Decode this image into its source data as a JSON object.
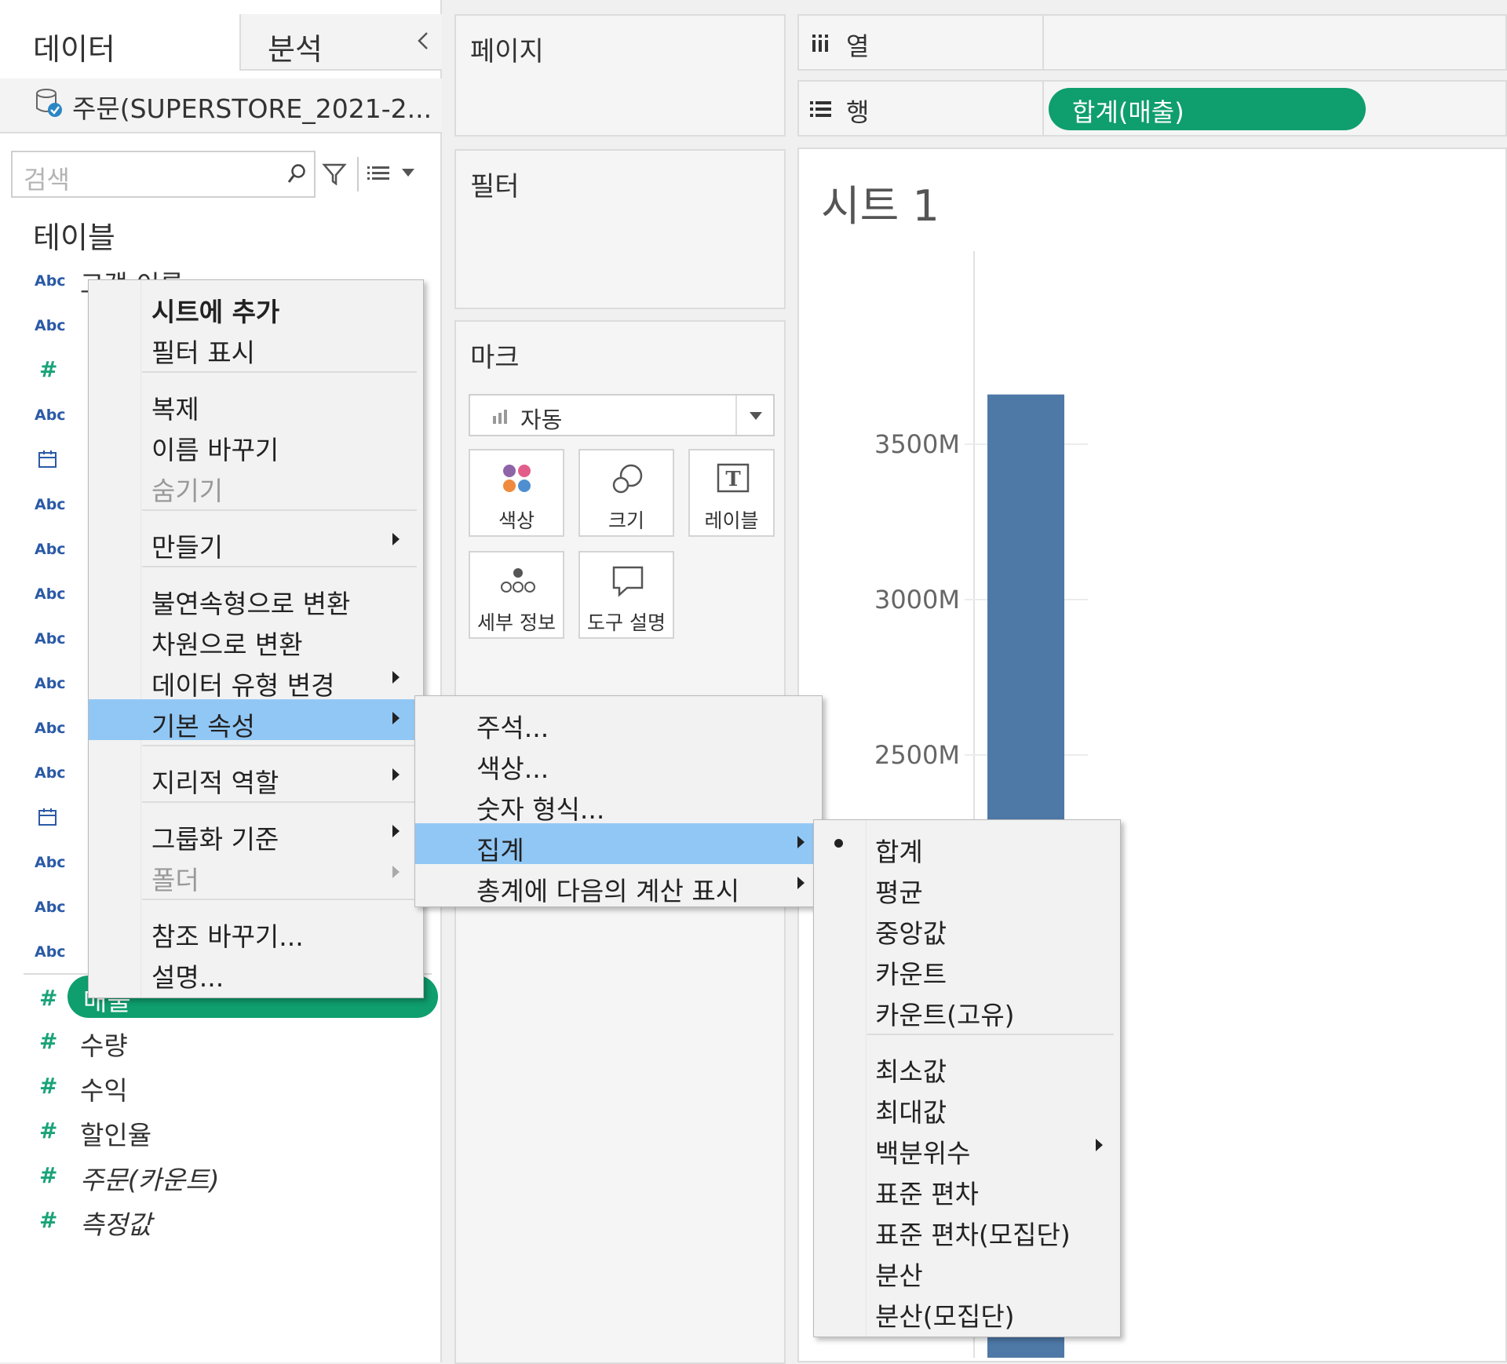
{
  "data_pane": {
    "tab_data": "데이터",
    "tab_analysis": "분석",
    "collapse_icon": "chevron-left-icon",
    "datasource": "주문(SUPERSTORE_2021-2...",
    "search_placeholder": "검색",
    "section_title": "테이블",
    "fields": [
      {
        "type": "abc",
        "name": "고객 이름"
      },
      {
        "type": "abc",
        "name": ""
      },
      {
        "type": "hash",
        "name": ""
      },
      {
        "type": "abc",
        "name": ""
      },
      {
        "type": "date",
        "name": ""
      },
      {
        "type": "abc",
        "name": ""
      },
      {
        "type": "abc",
        "name": ""
      },
      {
        "type": "abc",
        "name": ""
      },
      {
        "type": "abc",
        "name": ""
      },
      {
        "type": "abc",
        "name": ""
      },
      {
        "type": "abc",
        "name": ""
      },
      {
        "type": "abc",
        "name": ""
      },
      {
        "type": "date",
        "name": ""
      },
      {
        "type": "abc",
        "name": ""
      },
      {
        "type": "abc",
        "name": ""
      },
      {
        "type": "abc",
        "name": ""
      }
    ],
    "measures": [
      {
        "name": "매출",
        "italic": false,
        "selected": true
      },
      {
        "name": "수량",
        "italic": false,
        "selected": false
      },
      {
        "name": "수익",
        "italic": false,
        "selected": false
      },
      {
        "name": "할인율",
        "italic": false,
        "selected": false
      },
      {
        "name": "주문(카운트)",
        "italic": true,
        "selected": false
      },
      {
        "name": "측정값",
        "italic": true,
        "selected": false
      }
    ],
    "type_labels": {
      "abc": "Abc",
      "hash": "#"
    }
  },
  "cards": {
    "pages": "페이지",
    "filters": "필터",
    "marks": "마크",
    "mark_type": "자동",
    "mark_buttons": [
      {
        "label": "색상",
        "icon": "color-dots-icon"
      },
      {
        "label": "크기",
        "icon": "size-icon"
      },
      {
        "label": "레이블",
        "icon": "label-icon"
      },
      {
        "label": "세부 정보",
        "icon": "detail-icon"
      },
      {
        "label": "도구 설명",
        "icon": "tooltip-icon"
      }
    ]
  },
  "shelves": {
    "columns_label": "열",
    "rows_label": "행",
    "rows_pill": "합계(매출)"
  },
  "sheet": {
    "title": "시트 1"
  },
  "chart_data": {
    "type": "bar",
    "ylabel": "",
    "y_ticks": [
      "3500M",
      "3000M",
      "2500M"
    ],
    "bar_color": "#4e79a7",
    "series": [
      {
        "values": [
          3660
        ]
      }
    ]
  },
  "context_menu": {
    "items": [
      "시트에 추가",
      "필터 표시",
      "복제",
      "이름 바꾸기",
      "숨기기",
      "만들기",
      "불연속형으로 변환",
      "차원으로 변환",
      "데이터 유형 변경",
      "기본 속성",
      "지리적 역할",
      "그룹화 기준",
      "폴더",
      "참조 바꾸기...",
      "설명..."
    ]
  },
  "submenu_default_props": {
    "items": [
      "주석...",
      "색상...",
      "숫자 형식...",
      "집계",
      "총계에 다음의 계산 표시"
    ]
  },
  "submenu_aggregation": {
    "items": [
      "합계",
      "평균",
      "중앙값",
      "카운트",
      "카운트(고유)",
      "최소값",
      "최대값",
      "백분위수",
      "표준 편차",
      "표준 편차(모집단)",
      "분산",
      "분산(모집단)"
    ]
  },
  "colors": {
    "accent_green": "#0f9e6e",
    "highlight": "#91c7f5",
    "bar": "#4e79a7"
  }
}
